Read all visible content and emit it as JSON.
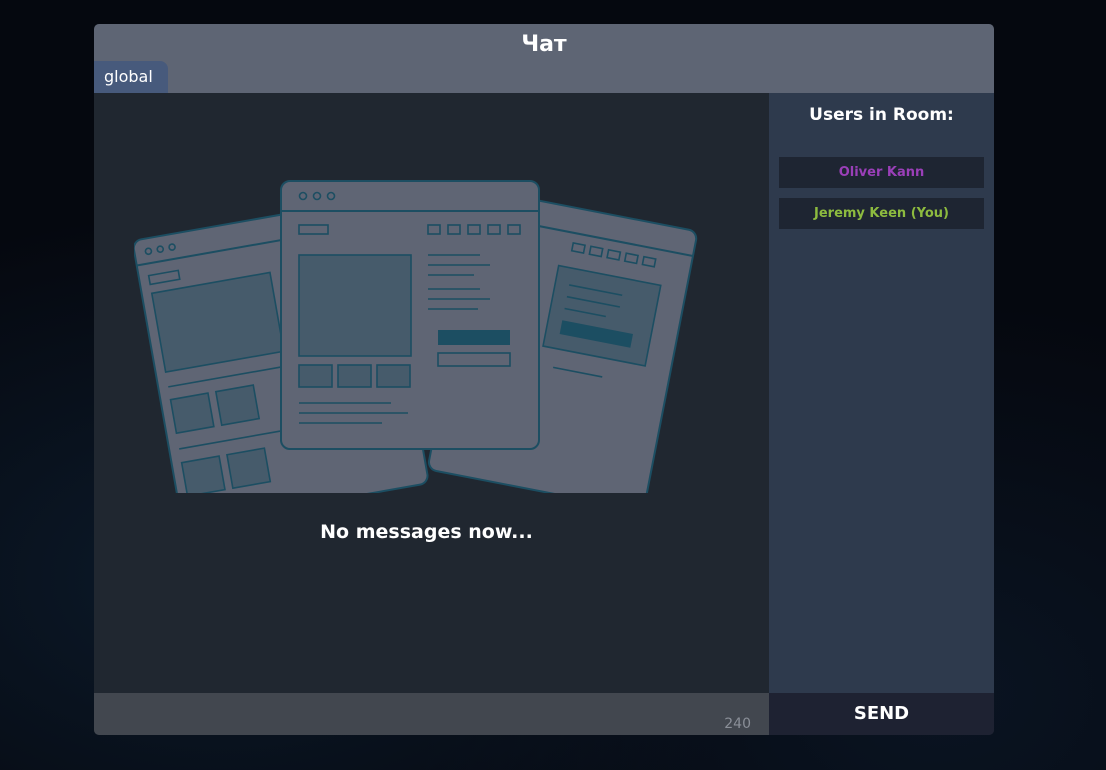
{
  "header": {
    "title": "Чат"
  },
  "tabs": [
    {
      "label": "global"
    }
  ],
  "messages": {
    "empty_text": "No messages now..."
  },
  "users_panel": {
    "title": "Users in Room:",
    "users": [
      {
        "name": "Oliver Kann",
        "color": "#9a3fb8"
      },
      {
        "name": "Jeremy Keen (You)",
        "color": "#8dbb3f"
      }
    ]
  },
  "composer": {
    "value": "",
    "char_count": "240",
    "send_label": "SEND"
  },
  "colors": {
    "header_bg": "#5e6574",
    "tab_bg": "#475a7c",
    "panel_bg": "#2e3a4d",
    "illustration_stroke": "#1c4e62"
  }
}
